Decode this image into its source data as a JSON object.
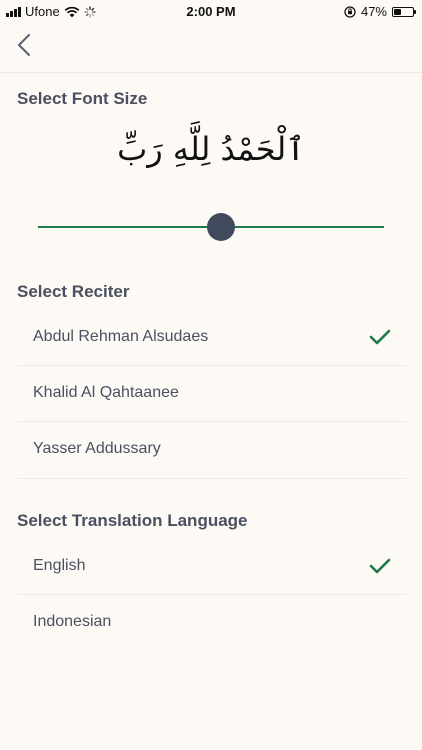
{
  "status_bar": {
    "carrier": "Ufone",
    "time": "2:00 PM",
    "battery": "47%",
    "battery_level": 0.47
  },
  "nav": {
    "back_icon": "chevron-left-icon"
  },
  "font_size": {
    "title": "Select Font Size",
    "preview_text": "ٱلْحَمْدُ لِلَّهِ رَبِّ",
    "slider_value": 0.53
  },
  "reciter": {
    "title": "Select Reciter",
    "items": [
      {
        "label": "Abdul Rehman Alsudaes",
        "selected": true
      },
      {
        "label": "Khalid Al Qahtaanee",
        "selected": false
      },
      {
        "label": "Yasser Addussary",
        "selected": false
      }
    ]
  },
  "translation": {
    "title": "Select Translation Language",
    "items": [
      {
        "label": "English",
        "selected": true
      },
      {
        "label": "Indonesian",
        "selected": false
      }
    ]
  },
  "colors": {
    "accent": "#1f7a4d",
    "thumb": "#414a5c",
    "background": "#fdfaf6"
  }
}
